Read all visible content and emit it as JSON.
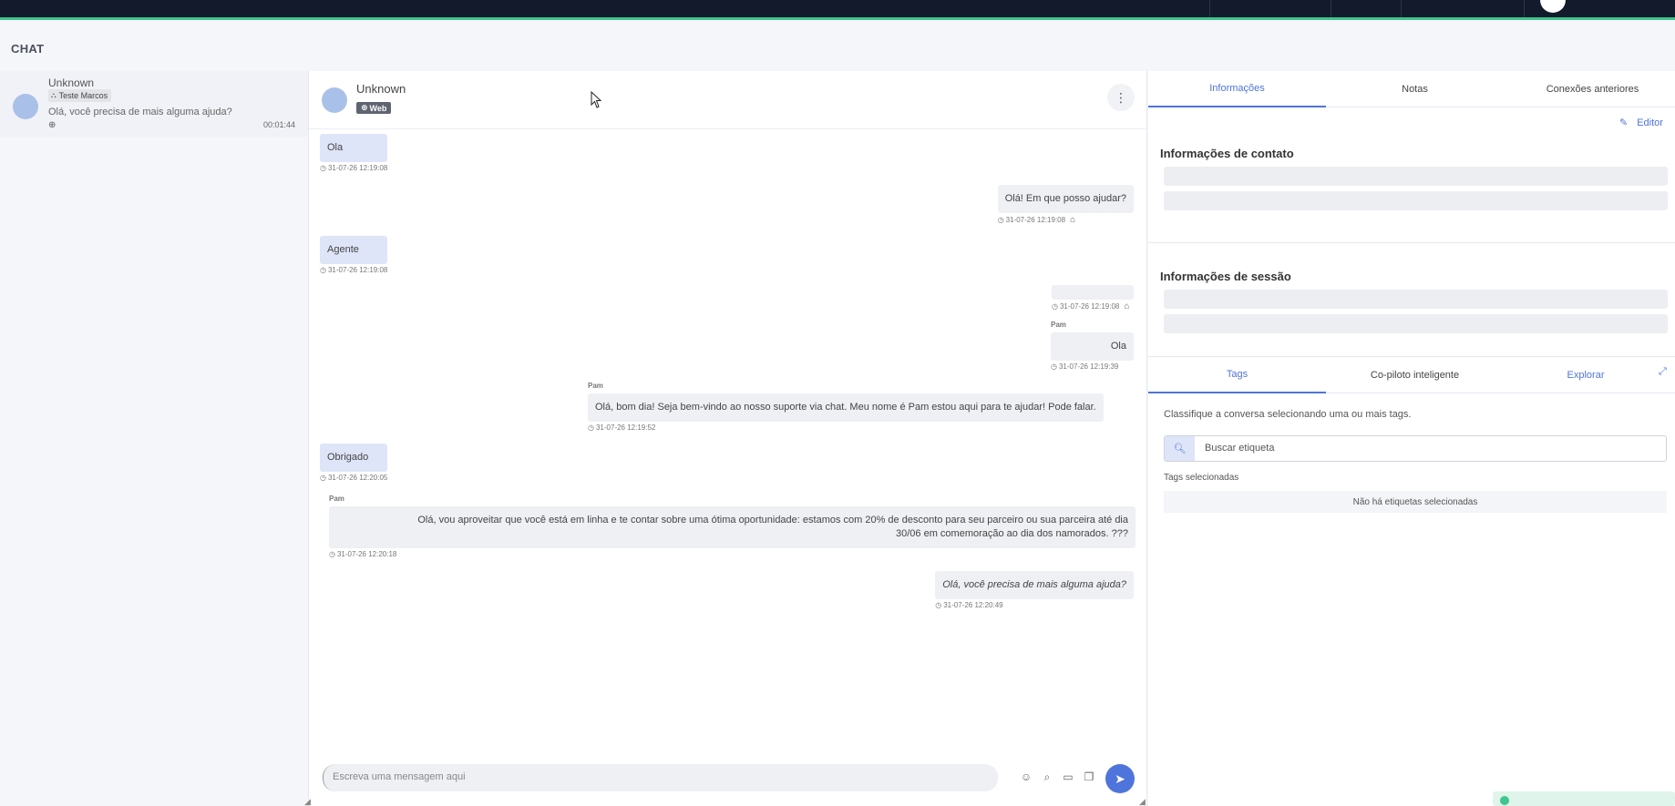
{
  "page_title": "CHAT",
  "conversation_list": {
    "items": [
      {
        "name": "Unknown",
        "tag": "Teste Marcos",
        "preview": "Olá, você precisa de mais alguma ajuda?",
        "time": "00:01:44"
      }
    ]
  },
  "chat": {
    "contact_name": "Unknown",
    "channel_badge": "Web",
    "messages": [
      {
        "dir": "in",
        "text": "Ola",
        "time": "31-07-26 12:19:08"
      },
      {
        "dir": "out",
        "text": "Olá! Em que posso ajudar?",
        "time": "31-07-26 12:19:08",
        "bot": true
      },
      {
        "dir": "in",
        "text": "Agente",
        "time": "31-07-26 12:19:08"
      },
      {
        "dir": "out",
        "text": "",
        "time": "31-07-26 12:19:08",
        "bot": true
      },
      {
        "dir": "out",
        "sender": "Pam",
        "text": "Ola",
        "time": "31-07-26 12:19:39"
      },
      {
        "dir": "out",
        "sender": "Pam",
        "text": "Olá, bom dia! Seja bem-vindo ao nosso suporte via chat. Meu nome é Pam estou aqui para te ajudar! Pode falar.",
        "time": "31-07-26 12:19:52"
      },
      {
        "dir": "in",
        "text": "Obrigado",
        "time": "31-07-26 12:20:05"
      },
      {
        "dir": "out",
        "sender": "Pam",
        "text_line1": "Olá, vou aproveitar que você está em linha e te contar sobre uma ótima oportunidade: estamos com 20% de desconto para seu parceiro ou sua parceira até dia",
        "text_line2": "30/06 em comemoração ao dia dos namorados. ???",
        "time": "31-07-26 12:20:18"
      },
      {
        "dir": "out",
        "text": "Olá, você precisa de mais alguma ajuda?",
        "time": "31-07-26 12:20:49"
      }
    ],
    "composer_placeholder": "Escreva uma mensagem aqui"
  },
  "right_panel": {
    "tabs": [
      "Informações",
      "Notas",
      "Conexões anteriores"
    ],
    "edit_label": "Editor",
    "contact_info_title": "Informações de contato",
    "session_info_title": "Informações de sessão",
    "tabs2": [
      "Tags",
      "Co-piloto inteligente",
      "Explorar"
    ],
    "classify_text": "Classifique a conversa selecionando uma ou mais tags.",
    "search_placeholder": "Buscar etiqueta",
    "selected_tags_label": "Tags selecionadas",
    "no_tags_text": "Não há etiquetas selecionadas"
  },
  "colors": {
    "accent": "#4f74db",
    "topbar": "#121a2b",
    "topbar_border": "#3fc58d",
    "incoming_bubble": "#dfe5f8",
    "outgoing_bubble": "#eff0f4"
  }
}
